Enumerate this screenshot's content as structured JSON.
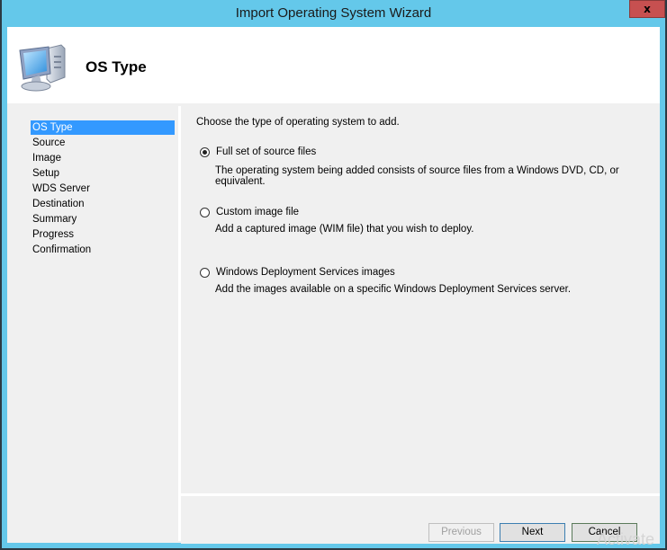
{
  "window": {
    "title": "Import Operating System Wizard",
    "close_label": "x"
  },
  "header": {
    "icon": "computer-icon",
    "page_title": "OS Type"
  },
  "sidebar": {
    "steps": [
      {
        "label": "OS Type",
        "active": true
      },
      {
        "label": "Source",
        "active": false
      },
      {
        "label": "Image",
        "active": false
      },
      {
        "label": "Setup",
        "active": false
      },
      {
        "label": "WDS Server",
        "active": false
      },
      {
        "label": "Destination",
        "active": false
      },
      {
        "label": "Summary",
        "active": false
      },
      {
        "label": "Progress",
        "active": false
      },
      {
        "label": "Confirmation",
        "active": false
      }
    ],
    "selected_color": "#3399ff"
  },
  "main": {
    "instruction": "Choose the type of operating system to add.",
    "options": [
      {
        "label": "Full set of source files",
        "description": "The operating system being added consists of source files from a Windows DVD, CD, or equivalent.",
        "checked": true
      },
      {
        "label": "Custom image file",
        "description": "Add a captured image (WIM file) that you wish to deploy.",
        "checked": false
      },
      {
        "label": "Windows Deployment Services images",
        "description": "Add the images available on a specific Windows Deployment Services server.",
        "checked": false
      }
    ]
  },
  "footer": {
    "previous_label": "Previous",
    "next_label": "Next",
    "cancel_label": "Cancel"
  },
  "watermark": "Activate",
  "colors": {
    "titlebar": "#64c8ea",
    "close_button": "#c75050"
  }
}
